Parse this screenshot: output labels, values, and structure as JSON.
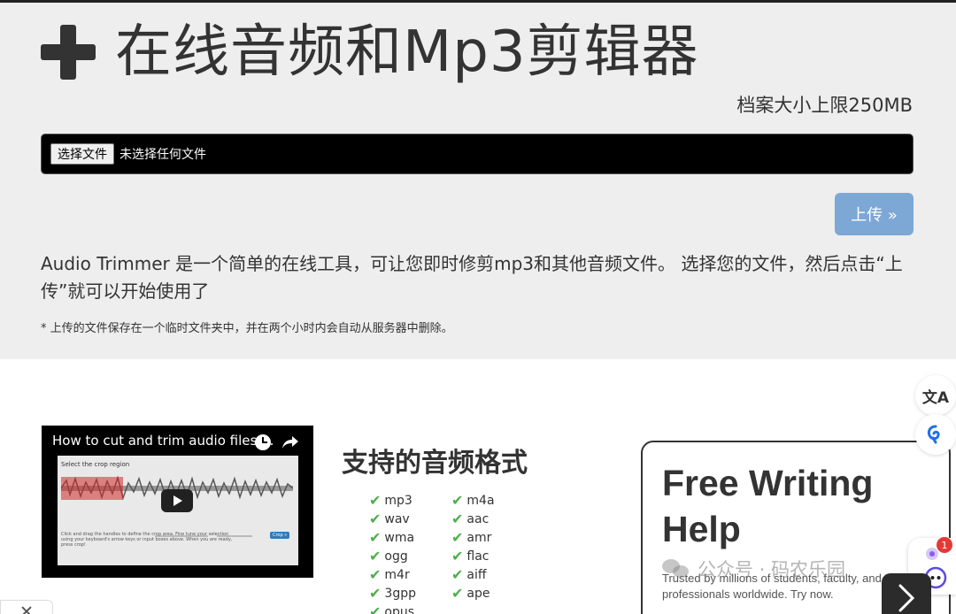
{
  "header": {
    "title": "在线音频和Mp3剪辑器",
    "size_limit": "档案大小上限250MB"
  },
  "upload": {
    "choose_file_label": "选择文件",
    "file_status": "未选择任何文件",
    "upload_button": "上传 »"
  },
  "description": "Audio Trimmer 是一个简单的在线工具，可让您即时修剪mp3和其他音频文件。 选择您的文件，然后点击“上传”就可以开始使用了",
  "note": "* 上传的文件保存在一个临时文件夹中，并在两个小时内会自动从服务器中删除。",
  "video": {
    "title": "How to cut and trim audio files ...",
    "step_text": "Select the crop region",
    "help_text": "Click and drag the handles to define the crop area. Fine tune your selection using your keyboard's arrow keys or input boxes above. When you are ready, press crop!",
    "crop_button": "Crop »"
  },
  "formats": {
    "title": "支持的音频格式",
    "column1": [
      "mp3",
      "wav",
      "wma",
      "ogg",
      "m4r",
      "3gpp",
      "opus"
    ],
    "column2": [
      "m4a",
      "aac",
      "amr",
      "flac",
      "aiff",
      "ape"
    ]
  },
  "ad": {
    "title": "Free Writing Help",
    "subtitle": "Trusted by millions of students, faculty, and professionals worldwide. Try now."
  },
  "watermark": {
    "text": "公众号 · 码农乐园"
  },
  "floating": {
    "translate_icon_text": "文A",
    "badge_count": "1"
  },
  "colors": {
    "hero_bg": "#eeeeee",
    "upload_btn": "#7da7d5",
    "check": "#4cae4c",
    "badge": "#e53935"
  }
}
